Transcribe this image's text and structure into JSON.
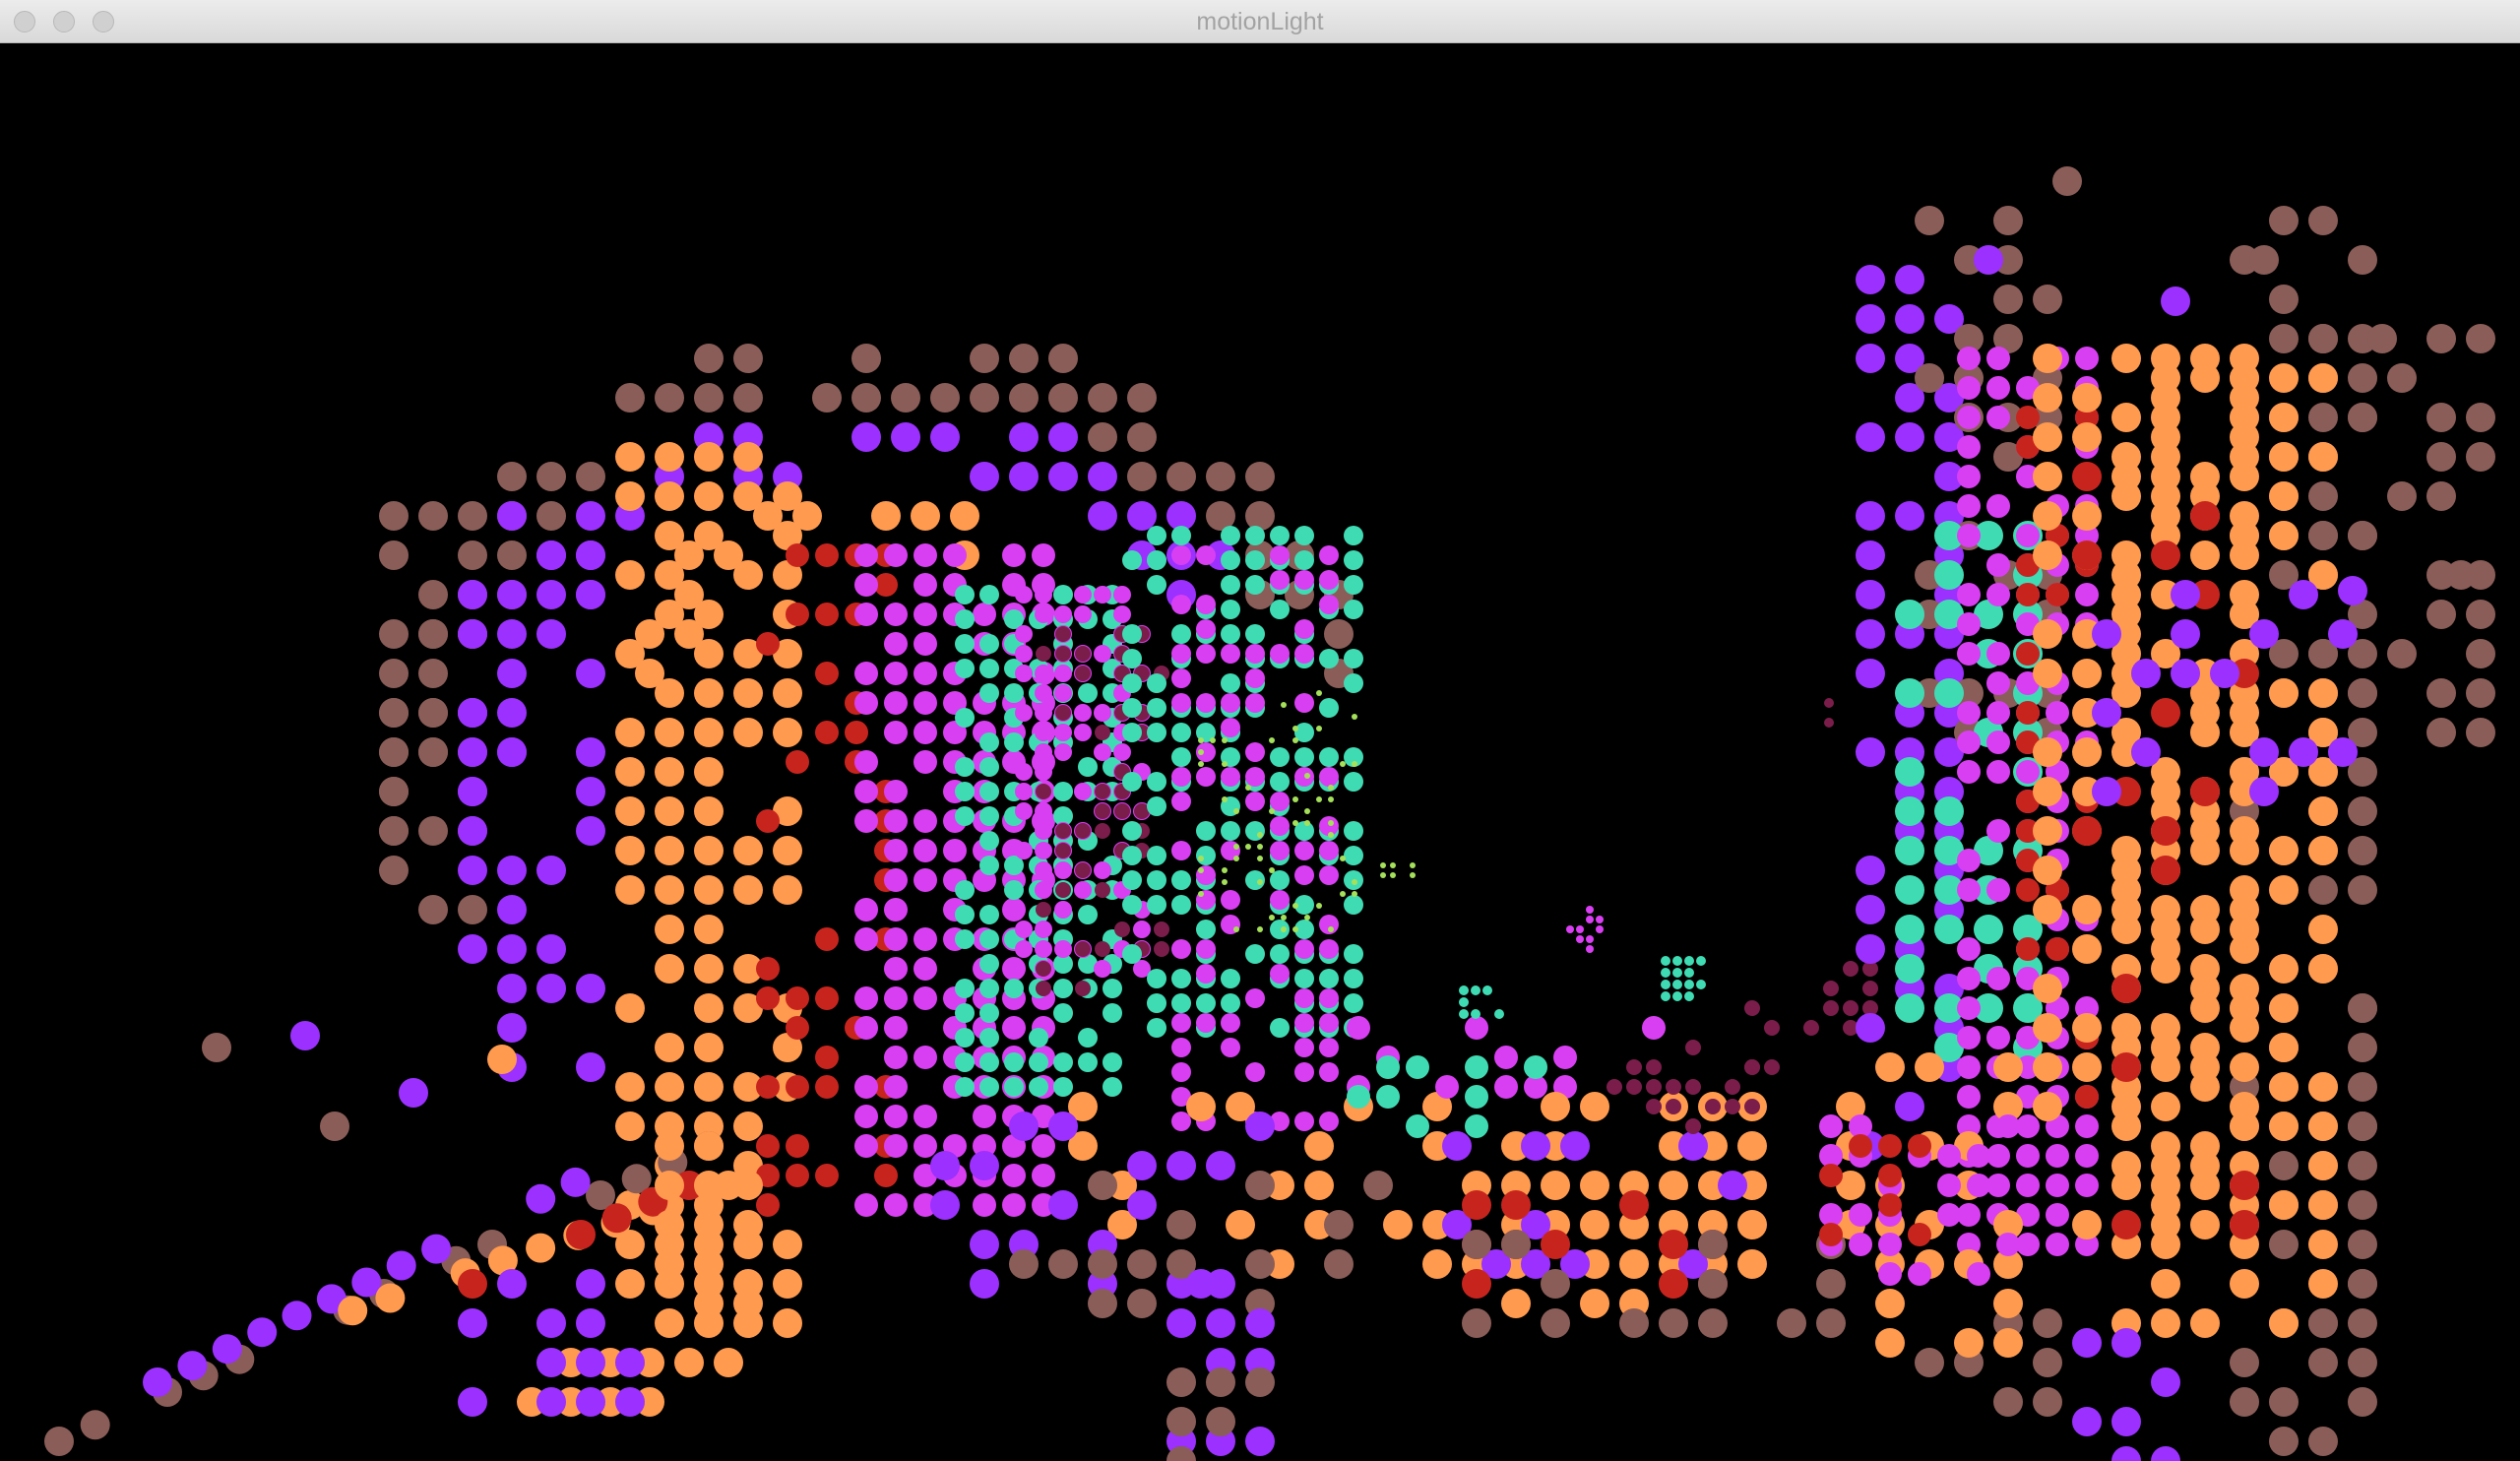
{
  "window": {
    "title": "motionLight",
    "controls": [
      "close-button",
      "minimize-button",
      "zoom-button"
    ]
  },
  "canvas": {
    "background": "#000000",
    "palette": {
      "brown": "#8a5d58",
      "violet": "#9b30ff",
      "orange": "#ff9a4e",
      "red": "#c8241e",
      "magenta": "#d93ff2",
      "teal": "#3fdcb4",
      "plum": "#7a1d4a",
      "lime": "#a5e05a"
    }
  }
}
